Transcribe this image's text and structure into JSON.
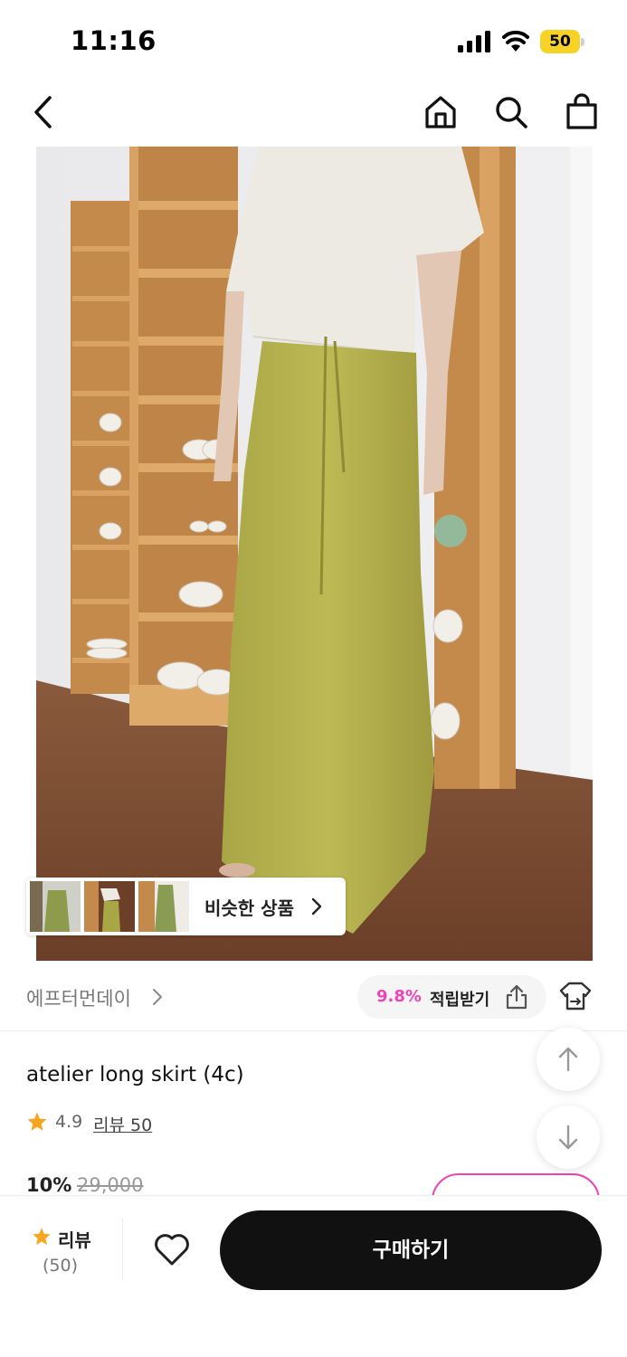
{
  "status_bar": {
    "time": "11:16",
    "battery_level": "50",
    "battery_color": "#f7d227"
  },
  "nav": {
    "icons": [
      "back-icon",
      "home-icon",
      "search-icon",
      "shopping-bag-icon"
    ]
  },
  "product_image": {
    "similar_items_label": "비슷한 상품",
    "thumbnail_count": 3
  },
  "brand_row": {
    "brand_name": "에프터먼데이",
    "reward_percent": "9.8%",
    "reward_label": "적립받기",
    "icons": [
      "share-icon",
      "fitting-icon"
    ]
  },
  "product": {
    "title": "atelier long skirt (4c)",
    "rating": "4.9",
    "review_link": "리뷰 50",
    "discount": "10%",
    "original_price": "29,000"
  },
  "bottom_bar": {
    "review_label": "리뷰",
    "review_count": "(50)",
    "buy_label": "구매하기",
    "icons": [
      "star-icon",
      "heart-icon"
    ]
  },
  "colors": {
    "accent_pink": "#ee44b5",
    "star_orange": "#f6a623",
    "buy_button": "#111111"
  }
}
